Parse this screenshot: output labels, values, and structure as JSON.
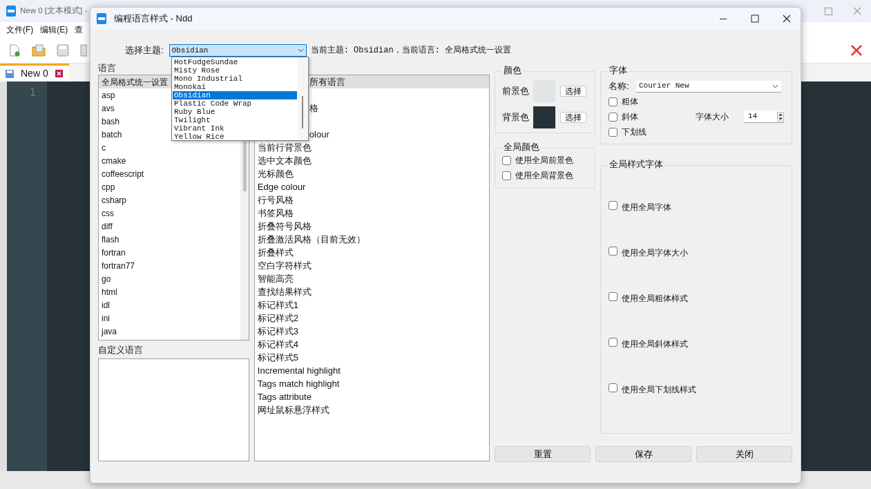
{
  "back_window": {
    "title": "New 0 [文本模式] -",
    "menu": [
      "文件(F)",
      "编辑(E)",
      "查"
    ],
    "tab": {
      "label": "New 0"
    },
    "line_number": "1"
  },
  "dialog": {
    "title": "编程语言样式 - Ndd"
  },
  "theme": {
    "label": "选择主题:",
    "value": "Obsidian",
    "options": [
      {
        "label": "HotFudgeSundae",
        "selected": false
      },
      {
        "label": "Misty Rose",
        "selected": false
      },
      {
        "label": "Mono Industrial",
        "selected": false
      },
      {
        "label": "Monokai",
        "selected": false
      },
      {
        "label": "Obsidian",
        "selected": true
      },
      {
        "label": "Plastic Code Wrap",
        "selected": false
      },
      {
        "label": "Ruby Blue",
        "selected": false
      },
      {
        "label": "Twilight",
        "selected": false
      },
      {
        "label": "Vibrant Ink",
        "selected": false
      },
      {
        "label": "Yellow Rice",
        "selected": false
      }
    ]
  },
  "status_text": "当前主题: Obsidian，当前语言: 全局格式统一设置",
  "languages": {
    "label": "语言",
    "items": [
      {
        "text": "全局格式统一设置",
        "selected": true
      },
      {
        "text": "asp",
        "selected": false
      },
      {
        "text": "avs",
        "selected": false
      },
      {
        "text": "bash",
        "selected": false
      },
      {
        "text": "batch",
        "selected": false
      },
      {
        "text": "c",
        "selected": false
      },
      {
        "text": "cmake",
        "selected": false
      },
      {
        "text": "coffeescript",
        "selected": false
      },
      {
        "text": "cpp",
        "selected": false
      },
      {
        "text": "csharp",
        "selected": false
      },
      {
        "text": "css",
        "selected": false
      },
      {
        "text": "diff",
        "selected": false
      },
      {
        "text": "flash",
        "selected": false
      },
      {
        "text": "fortran",
        "selected": false
      },
      {
        "text": "fortran77",
        "selected": false
      },
      {
        "text": "go",
        "selected": false
      },
      {
        "text": "html",
        "selected": false
      },
      {
        "text": "idl",
        "selected": false
      },
      {
        "text": "ini",
        "selected": false
      },
      {
        "text": "java",
        "selected": false
      }
    ]
  },
  "custom_languages": {
    "label": "自定义语言"
  },
  "style_items": [
    {
      "kind": "covered-row",
      "text": "所有语言",
      "selected": true
    },
    {
      "kind": "hidden-row"
    },
    {
      "kind": "covered-row",
      "text": "格",
      "selected": false
    },
    {
      "kind": "hidden-row"
    },
    {
      "kind": "covered-row",
      "text": "olour",
      "selected": false
    },
    {
      "kind": "row",
      "text": "当前行背景色",
      "selected": false
    },
    {
      "kind": "row",
      "text": "选中文本颜色",
      "selected": false
    },
    {
      "kind": "row",
      "text": "光标颜色",
      "selected": false
    },
    {
      "kind": "row",
      "text": "Edge colour",
      "selected": false
    },
    {
      "kind": "row",
      "text": "行号风格",
      "selected": false
    },
    {
      "kind": "row",
      "text": "书签风格",
      "selected": false
    },
    {
      "kind": "row",
      "text": "折叠符号风格",
      "selected": false
    },
    {
      "kind": "row",
      "text": "折叠激活风格（目前无效）",
      "selected": false
    },
    {
      "kind": "row",
      "text": "折叠样式",
      "selected": false
    },
    {
      "kind": "row",
      "text": "空白字符样式",
      "selected": false
    },
    {
      "kind": "row",
      "text": "智能高亮",
      "selected": false
    },
    {
      "kind": "row",
      "text": "查找结果样式",
      "selected": false
    },
    {
      "kind": "row",
      "text": "标记样式1",
      "selected": false
    },
    {
      "kind": "row",
      "text": "标记样式2",
      "selected": false
    },
    {
      "kind": "row",
      "text": "标记样式3",
      "selected": false
    },
    {
      "kind": "row",
      "text": "标记样式4",
      "selected": false
    },
    {
      "kind": "row",
      "text": "标记样式5",
      "selected": false
    },
    {
      "kind": "row",
      "text": "Incremental highlight",
      "selected": false
    },
    {
      "kind": "row",
      "text": "Tags match highlight",
      "selected": false
    },
    {
      "kind": "row",
      "text": "Tags attribute",
      "selected": false
    },
    {
      "kind": "row",
      "text": "网址鼠标悬浮样式",
      "selected": false
    }
  ],
  "color": {
    "label": "颜色",
    "swatches": [
      {
        "label": "前景色",
        "color": "#e2e5e6",
        "button": "选择"
      },
      {
        "label": "背景色",
        "color": "#263238",
        "button": "选择"
      }
    ]
  },
  "global_color": {
    "label": "全局颜色",
    "options": [
      {
        "label": "使用全局前景色",
        "checked": false
      },
      {
        "label": "使用全局背景色",
        "checked": false
      }
    ]
  },
  "font": {
    "label": "字体",
    "name_label": "名称:",
    "name": "Courier New",
    "size_label": "字体大小",
    "size": "14",
    "options": [
      {
        "label": "粗体",
        "checked": false
      },
      {
        "label": "斜体",
        "checked": false
      },
      {
        "label": "下划线",
        "checked": false
      }
    ]
  },
  "global_font": {
    "label": "全局样式字体",
    "options": [
      {
        "label": "使用全局字体",
        "checked": false
      },
      {
        "label": "使用全局字体大小",
        "checked": false
      },
      {
        "label": "使用全局粗体样式",
        "checked": false
      },
      {
        "label": "使用全局斜体样式",
        "checked": false
      },
      {
        "label": "使用全局下划线样式",
        "checked": false
      }
    ]
  },
  "buttons": [
    "重置",
    "保存",
    "关闭"
  ]
}
